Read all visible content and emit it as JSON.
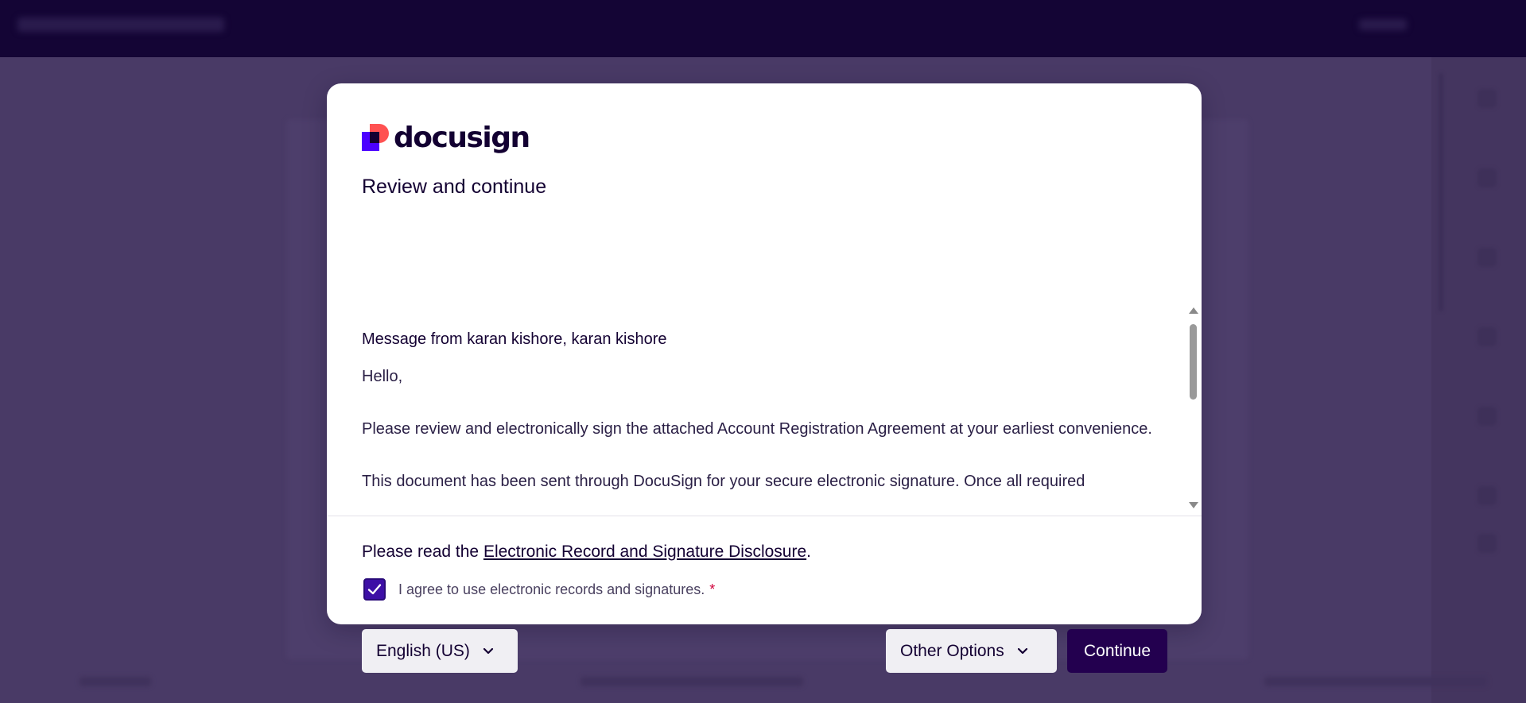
{
  "modal": {
    "brand": "docusign",
    "title": "Review and continue",
    "message_from": "Message from karan kishore, karan kishore",
    "message_body": "Hello,\n\nPlease review and electronically sign the attached Account Registration Agreement at your earliest convenience.\n\nThis document has been sent through DocuSign for your secure electronic signature. Once all required",
    "disclosure_prefix": "Please read the ",
    "disclosure_link": "Electronic Record and Signature Disclosure",
    "disclosure_suffix": ".",
    "agree_label": "I agree to use electronic records and signatures.",
    "agree_checked": true,
    "required_mark": "*",
    "language_button": "English (US)",
    "other_options_button": "Other Options",
    "continue_button": "Continue"
  },
  "colors": {
    "primary": "#23004f",
    "checkbox": "#3d0fa6",
    "logo_red": "#ff5252",
    "logo_purple": "#4c00ff",
    "overlay": "#493a66"
  }
}
